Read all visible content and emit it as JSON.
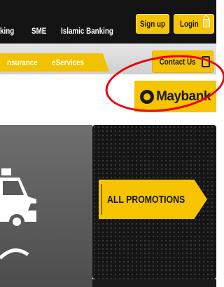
{
  "header": {
    "nav": [
      "king",
      "SME",
      "Islamic Banking"
    ],
    "signup_label": "Sign up",
    "login_label": "Login"
  },
  "tabs": [
    "nsurance",
    "eServices"
  ],
  "contact_label": "Contact Us",
  "logo_text": "Maybank",
  "promo_label": "ALL PROMOTIONS",
  "colors": {
    "brand_yellow": "#f6c400",
    "highlight_ring": "#e8000f",
    "header_dark": "#141414"
  }
}
